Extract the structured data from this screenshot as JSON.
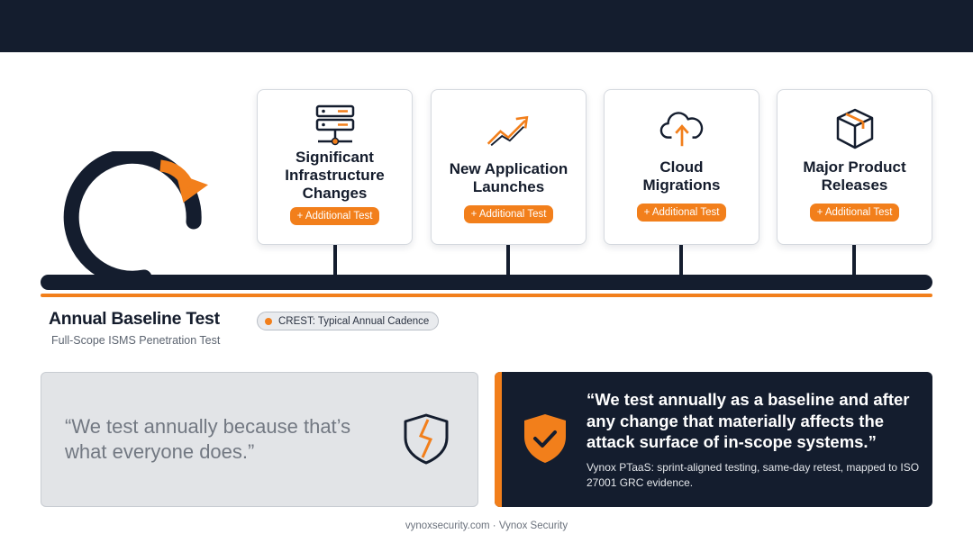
{
  "triggers": [
    {
      "title": "Significant\nInfrastructure\nChanges",
      "badge": "+ Additional Test",
      "icon": "server-icon"
    },
    {
      "title": "New Application\nLaunches",
      "badge": "+ Additional Test",
      "icon": "trend-arrow-icon"
    },
    {
      "title": "Cloud\nMigrations",
      "badge": "+ Additional Test",
      "icon": "cloud-upload-icon"
    },
    {
      "title": "Major Product\nReleases",
      "badge": "+ Additional Test",
      "icon": "package-box-icon"
    }
  ],
  "baseline": {
    "title": "Annual Baseline Test",
    "subtitle": "Full-Scope ISMS Penetration Test",
    "pill": "CREST: Typical Annual Cadence"
  },
  "myth": {
    "quote": "“We test annually because that’s what everyone does.”",
    "icon": "broken-shield-icon"
  },
  "truth": {
    "quote": "“We test annually as a baseline and after any change that materially affects the attack surface of in-scope systems.”",
    "description": "Vynox PTaaS: sprint-aligned testing, same-day retest, mapped to ISO 27001 GRC evidence.",
    "icon": "shield-check-icon"
  },
  "footer": "vynoxsecurity.com · Vynox Security",
  "colors": {
    "navy": "#141d2e",
    "orange": "#f27f1b",
    "grey_panel": "#e2e4e7"
  }
}
